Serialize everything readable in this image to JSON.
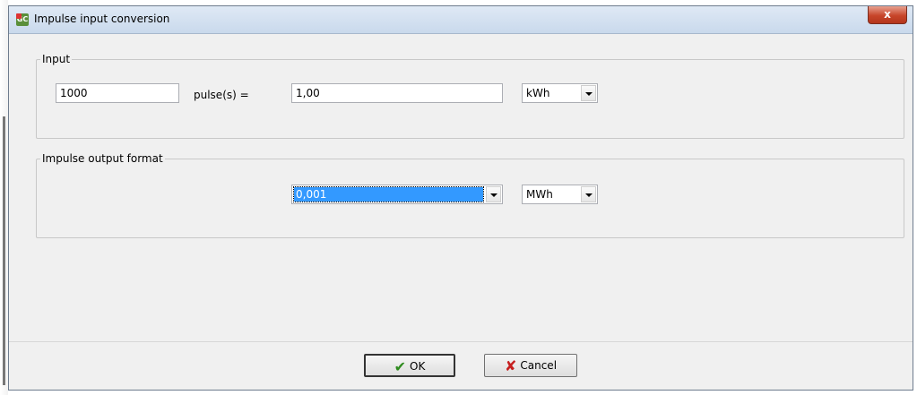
{
  "window": {
    "title": "Impulse input conversion",
    "close_label": "x"
  },
  "app_icon": {
    "text": "GC",
    "colors": [
      "#5a8f3a",
      "#d33333"
    ]
  },
  "input_group": {
    "legend": "Input",
    "pulses_value": "1000",
    "pulse_label": "pulse(s) =",
    "amount_value": "1,00",
    "unit_selected": "kWh"
  },
  "output_group": {
    "legend": "Impulse output format",
    "format_selected": "0,001",
    "unit_selected": "MWh"
  },
  "buttons": {
    "ok_label": "OK",
    "cancel_label": "Cancel",
    "ok_icon": "check-icon",
    "cancel_icon": "cross-icon"
  },
  "colors": {
    "selection": "#3399ff",
    "close_button": "#c7452a",
    "ok_check": "#2e8b1e",
    "cancel_cross": "#c62020"
  }
}
